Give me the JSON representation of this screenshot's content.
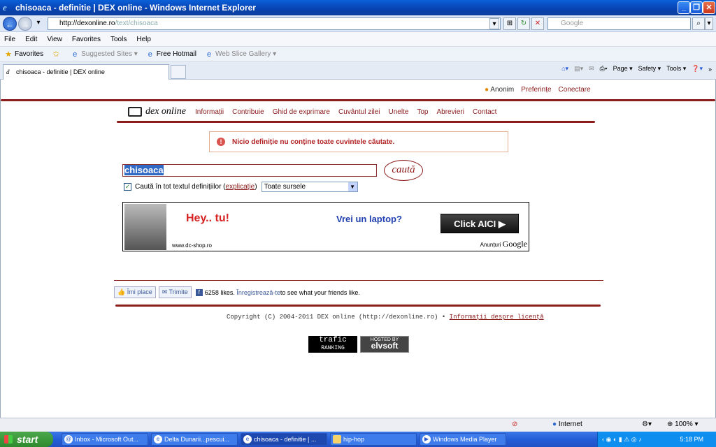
{
  "window": {
    "title": "chisoaca - definitie | DEX online - Windows Internet Explorer"
  },
  "browser": {
    "url_host": "http://dexonline.ro",
    "url_path": "/text/chisoaca",
    "search_placeholder": "Google",
    "menu": [
      "File",
      "Edit",
      "View",
      "Favorites",
      "Tools",
      "Help"
    ],
    "favorites": [
      "Favorites",
      "Suggested Sites ▾",
      "Free Hotmail",
      "Web Slice Gallery ▾"
    ],
    "tab_title": "chisoaca - definitie | DEX online",
    "commands": [
      "Page ▾",
      "Safety ▾",
      "Tools ▾"
    ]
  },
  "site": {
    "user": {
      "name": "Anonim",
      "prefs": "Preferințe",
      "login": "Conectare"
    },
    "logo_text": "dex online",
    "nav": [
      "Informații",
      "Contribuie",
      "Ghid de exprimare",
      "Cuvântul zilei",
      "Unelte",
      "Top",
      "Abrevieri",
      "Contact"
    ],
    "error": "Nicio definiție nu conține toate cuvintele căutate.",
    "search_value": "chisoaca",
    "search_button": "caută",
    "fulltext_label": "Caută în tot textul definițiilor",
    "explain_link": "explicație",
    "sources_selected": "Toate sursele",
    "ad": {
      "headline": "Hey.. tu!",
      "offer": "Vrei un laptop?",
      "cta": "Click AICI",
      "site": "www.dc-shop.ro",
      "ads_by": "Anunțuri",
      "ads_brand": "Google"
    },
    "social": {
      "like": "Îmi place",
      "send": "Trimite",
      "likes_count": "6258 likes.",
      "register": "Înregistrează-te",
      "register_rest": " to see what your friends like."
    },
    "copyright": "Copyright (C) 2004-2011 DEX online (http://dexonline.ro) •",
    "license_link": "Informații despre licență",
    "badge1_top": "trafic",
    "badge1_bottom": "RANKING",
    "badge2_top": "HOSTED BY",
    "badge2_bottom": "elvsoft"
  },
  "statusbar": {
    "zone": "Internet",
    "zoom": "100%"
  },
  "taskbar": {
    "start": "start",
    "tasks": [
      "Inbox - Microsoft Out...",
      "Delta Dunarii...pescui...",
      "chisoaca - definitie | ...",
      "hip-hop",
      "Windows Media Player"
    ],
    "clock": "5:18 PM"
  }
}
